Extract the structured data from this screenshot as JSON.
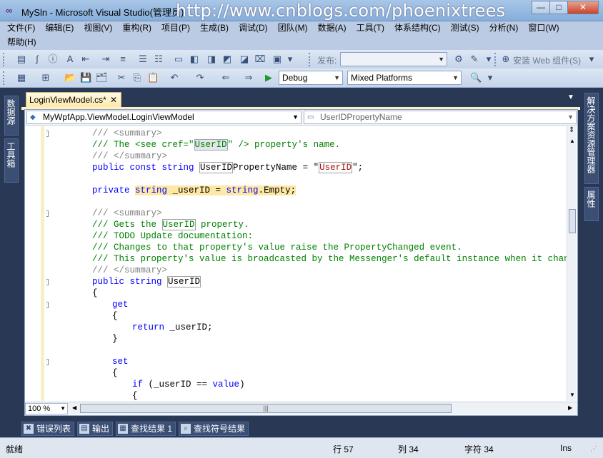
{
  "window": {
    "title": "MySln - Microsoft Visual Studio(管理员)",
    "watermark": "http://www.cnblogs.com/phoenixtrees",
    "controls": {
      "minimize": "—",
      "maximize": "□",
      "close": "✕"
    }
  },
  "menu": {
    "row1": [
      "文件(F)",
      "编辑(E)",
      "视图(V)",
      "重构(R)",
      "项目(P)",
      "生成(B)",
      "调试(D)",
      "团队(M)",
      "数据(A)",
      "工具(T)",
      "体系结构(C)",
      "测试(S)",
      "分析(N)",
      "窗口(W)"
    ],
    "row2": [
      "帮助(H)"
    ]
  },
  "toolbar1": {
    "publish_label": "发布:",
    "install_web_component": "安装 Web 组件(S)"
  },
  "toolbar2": {
    "configuration": "Debug",
    "platform": "Mixed Platforms"
  },
  "side": {
    "left_tabs": [
      "数据源",
      "工具箱"
    ],
    "right_tabs": [
      "解决方案资源管理器",
      "属性"
    ]
  },
  "document": {
    "tab_label": "LoginViewModel.cs*",
    "tab_close": "✕",
    "type_selector": "MyWpfApp.ViewModel.LoginViewModel",
    "member_selector": "UserIDPropertyName",
    "zoom": "100 %"
  },
  "code": {
    "l1": "/// <summary>",
    "l2a": "/// The <see cref=\"",
    "l2b": "UserID",
    "l2c": "\" /> property's name.",
    "l3": "/// </summary>",
    "l4a": "public const string ",
    "l4b": "UserID",
    "l4c": "PropertyName = \"",
    "l4d": "UserID",
    "l4e": "\";",
    "l5a": "private ",
    "l5b": "string",
    "l5c": " _userID = ",
    "l5d": "string",
    "l5e": ".Empty;",
    "l6": "/// <summary>",
    "l7a": "/// Gets the ",
    "l7b": "UserID",
    "l7c": " property.",
    "l8": "/// TODO Update documentation:",
    "l9": "/// Changes to that property's value raise the PropertyChanged event.",
    "l10": "/// This property's value is broadcasted by the Messenger's default instance when it changes.",
    "l11": "/// </summary>",
    "l12a": "public string ",
    "l12b": "UserID",
    "l13": "{",
    "l14": "get",
    "l15": "{",
    "l16a": "return",
    "l16b": " _userID;",
    "l17": "}",
    "l18": "set",
    "l19": "{",
    "l20a": "if",
    "l20b": " (_userID == ",
    "l20c": "value",
    "l20d": ")",
    "l21": "{"
  },
  "bottom_tabs": [
    "错误列表",
    "输出",
    "查找结果 1",
    "查找符号结果"
  ],
  "status": {
    "ready": "就绪",
    "line": "行 57",
    "column": "列 34",
    "char": "字符 34",
    "mode": "Ins"
  }
}
